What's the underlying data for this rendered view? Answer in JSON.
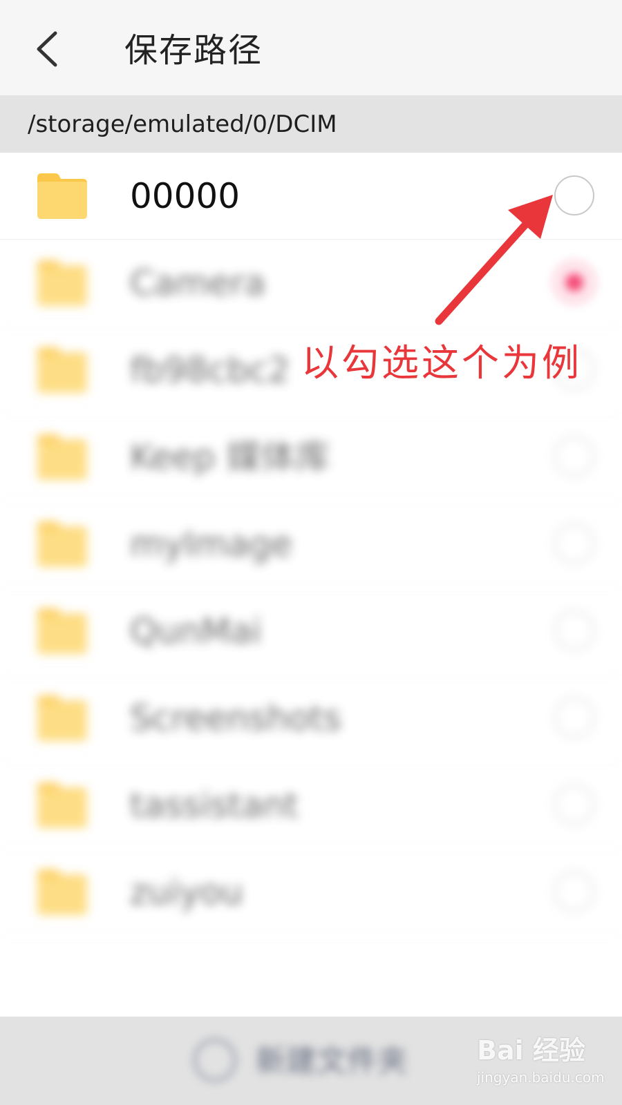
{
  "header": {
    "title": "保存路径",
    "back_icon": "chevron-left-icon"
  },
  "path_bar": {
    "path": "/storage/emulated/0/DCIM"
  },
  "folders": [
    {
      "name": "00000",
      "selected": false,
      "blurred": false
    },
    {
      "name": "Camera",
      "selected": true,
      "blurred": true
    },
    {
      "name": "fb98cbc2",
      "selected": false,
      "blurred": true
    },
    {
      "name": "Keep 媒体库",
      "selected": false,
      "blurred": true
    },
    {
      "name": "myImage",
      "selected": false,
      "blurred": true
    },
    {
      "name": "QunMai",
      "selected": false,
      "blurred": true
    },
    {
      "name": "Screenshots",
      "selected": false,
      "blurred": true
    },
    {
      "name": "tassistant",
      "selected": false,
      "blurred": true
    },
    {
      "name": "zuiyou",
      "selected": false,
      "blurred": true
    }
  ],
  "annotation": {
    "text": "以勾选这个为例",
    "color": "#e8363a"
  },
  "bottom_bar": {
    "new_folder_label": "新建文件夹",
    "icon": "plus-circle-icon"
  },
  "watermark": {
    "main": "Bai 经验",
    "sub": "jingyan.baidu.com"
  },
  "colors": {
    "accent": "#f3245a",
    "folder": "#fdd56a"
  }
}
